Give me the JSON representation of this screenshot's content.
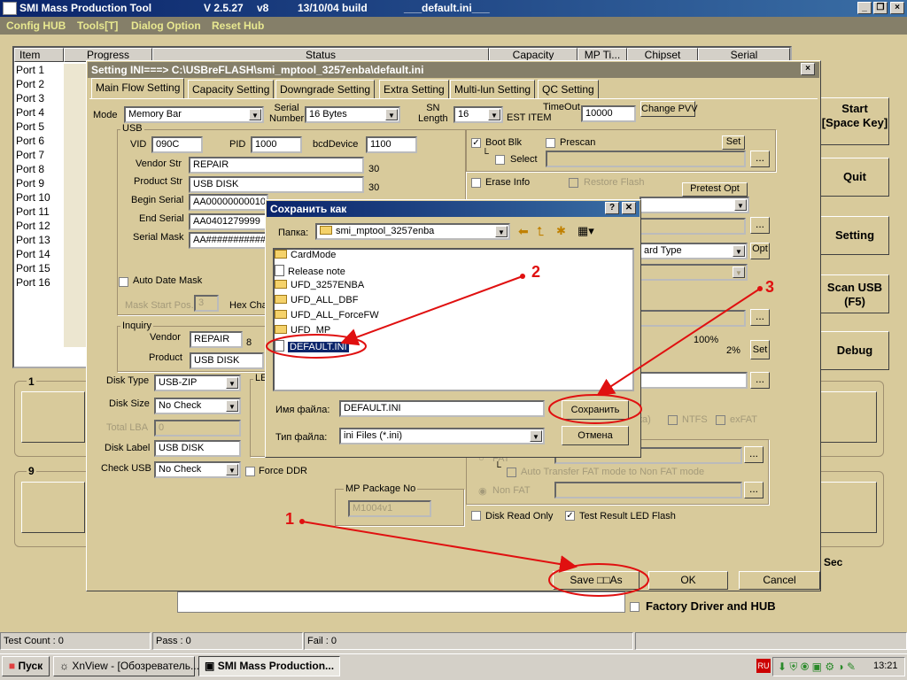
{
  "app": {
    "title": "SMI Mass Production Tool",
    "version": "V 2.5.27",
    "vnum": "v8",
    "build": "13/10/04 build",
    "ini": "___default.ini___"
  },
  "menu": [
    "Config HUB",
    "Tools[T]",
    "Dialog Option",
    "Reset Hub"
  ],
  "table": {
    "headers": [
      "Item",
      "Progress",
      "Status",
      "Capacity",
      "MP Ti...",
      "Chipset",
      "Serial"
    ],
    "ports": [
      "Port 1",
      "Port 2",
      "Port 3",
      "Port 4",
      "Port 5",
      "Port 6",
      "Port 7",
      "Port 8",
      "Port 9",
      "Port 10",
      "Port 11",
      "Port 12",
      "Port 13",
      "Port 14",
      "Port 15",
      "Port 16"
    ]
  },
  "right_buttons": {
    "start": "Start\n[Space Key]",
    "quit": "Quit",
    "setting": "Setting",
    "scan": "Scan USB\n(F5)",
    "debug": "Debug"
  },
  "panel_nums": {
    "a": "1",
    "b": "9"
  },
  "sec": "Sec",
  "factory": "Factory Driver and HUB",
  "status_bar": {
    "test_count": "Test Count : 0",
    "pass": "Pass : 0",
    "fail": "Fail : 0"
  },
  "setting": {
    "title": "Setting  INI===> C:\\USBreFLASH\\smi_mptool_3257enba\\default.ini",
    "tabs": [
      "Main Flow Setting",
      "Capacity Setting",
      "Downgrade Setting",
      "Extra Setting",
      "Multi-lun Setting",
      "QC Setting"
    ],
    "mode_label": "Mode",
    "mode_value": "Memory Bar",
    "serial_number_label": "Serial\nNumber",
    "serial_number_value": "16 Bytes",
    "sn_length_label": "SN\nLength",
    "sn_length_value": "16",
    "est_item": "EST ITEM",
    "timeout_label": "TimeOut",
    "timeout_value": "10000",
    "change_pvv": "Change PVV",
    "usb": {
      "group": "USB",
      "vid_label": "VID",
      "vid": "090C",
      "pid_label": "PID",
      "pid": "1000",
      "bcd_label": "bcdDevice",
      "bcd": "1100",
      "vendor_str_label": "Vendor Str",
      "vendor_str": "REPAIR",
      "vendor_len": "30",
      "product_str_label": "Product Str",
      "product_str": "USB DISK",
      "product_len": "30",
      "begin_serial_label": "Begin Serial",
      "begin_serial": "AA00000000010",
      "end_serial_label": "End Serial",
      "end_serial": "AA0401279999",
      "serial_mask_label": "Serial Mask",
      "serial_mask": "AA############",
      "auto_date_mask": "Auto Date Mask",
      "mask_start_pos": "Mask Start Pos.",
      "mask_start_val": "3",
      "hex_cha": "Hex Cha"
    },
    "inquiry": {
      "group": "Inquiry",
      "vendor_label": "Vendor",
      "vendor": "REPAIR",
      "vendor_len": "8",
      "product_label": "Product",
      "product": "USB DISK"
    },
    "disk_type_label": "Disk Type",
    "disk_type": "USB-ZIP",
    "disk_size_label": "Disk Size",
    "disk_size": "No Check",
    "total_lba_label": "Total LBA",
    "total_lba": "0",
    "disk_label_label": "Disk Label",
    "disk_label": "USB DISK",
    "check_usb_label": "Check USB",
    "check_usb": "No Check",
    "force_ddr": "Force DDR",
    "le": "LE",
    "mp_package_label": "MP Package No",
    "mp_package": "M1004v1",
    "boot_blk": "Boot Blk",
    "prescan": "Prescan",
    "set": "Set",
    "select": "Select",
    "erase_info": "Erase Info",
    "restore_flash": "Restore Flash",
    "pretest_opt": "Pretest Opt",
    "ard_type": "ard Type",
    "opt": "Opt",
    "pct100": "100%",
    "pct2": "2%",
    "set2": "Set",
    "ta": "ta)",
    "ntfs": "NTFS",
    "exfat": "exFAT",
    "fat": "FAT",
    "auto_transfer": "Auto Transfer FAT mode to Non FAT mode",
    "non_fat": "Non FAT",
    "disk_read_only": "Disk Read Only",
    "test_result_led": "Test Result LED Flash",
    "save": "Save  □□As",
    "ok": "OK",
    "cancel": "Cancel"
  },
  "save_dialog": {
    "title": "Сохранить как",
    "help": "?",
    "close": "✕",
    "folder_label": "Папка:",
    "folder": "smi_mptool_3257enba",
    "items": [
      {
        "name": "CardMode",
        "type": "folder"
      },
      {
        "name": "Release note",
        "type": "file"
      },
      {
        "name": "UFD_3257ENBA",
        "type": "folder"
      },
      {
        "name": "UFD_ALL_DBF",
        "type": "folder"
      },
      {
        "name": "UFD_ALL_ForceFW",
        "type": "folder"
      },
      {
        "name": "UFD_MP",
        "type": "folder"
      },
      {
        "name": "DEFAULT.INI",
        "type": "file",
        "selected": true
      }
    ],
    "filename_label": "Имя файла:",
    "filename": "DEFAULT.INI",
    "filetype_label": "Тип файла:",
    "filetype": "ini Files (*.ini)",
    "save_btn": "Сохранить",
    "cancel_btn": "Отмена"
  },
  "annotations": [
    "1",
    "2",
    "3"
  ],
  "taskbar": {
    "start": "Пуск",
    "task1": "XnView - [Обозреватель...",
    "task2": "SMI Mass Production...",
    "lang": "RU",
    "clock": "13:21"
  }
}
